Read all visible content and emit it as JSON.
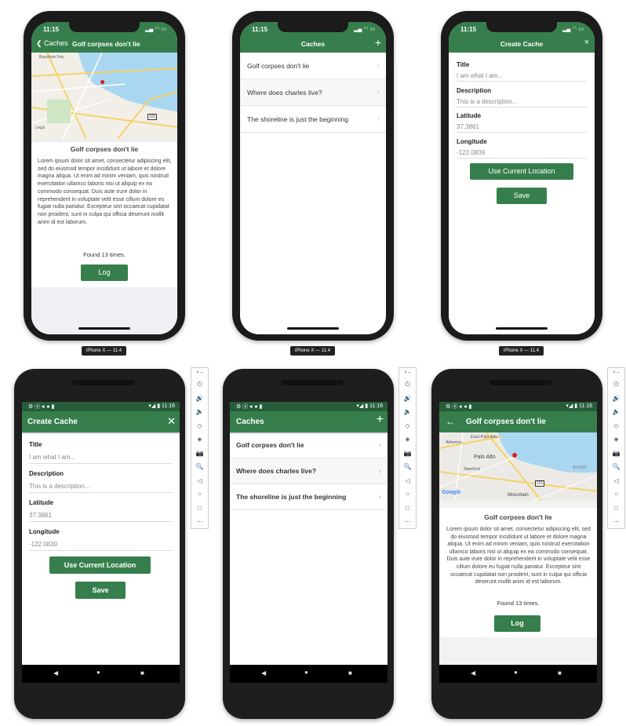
{
  "ios": {
    "time": "11:15",
    "device_label": "iPhone X — 11.4",
    "detail": {
      "back": "Caches",
      "title": "Golf corpses don't lie",
      "heading": "Golf corpses don't lie",
      "description": "Lorem ipsum dolor sit amet, consectetur adipiscing elit, sed do eiusmod tempor incididunt ut labore et dolore magna aliqua. Ut enim ad minim veniam, quis nostrud exercitation ullamco laboris nisi ut aliquip ex ea commodo consequat. Duis aute irure dolor in reprehenderit in voluptate velit esse cillum dolore eu fugiat nulla pariatur. Excepteur sint occaecat cupidatat non proident, sunt in culpa qui officia deserunt mollit anim id est laborum.",
      "found": "Found 13 times.",
      "log": "Log",
      "map_labels": {
        "road": "Bayshore Fwy",
        "hwy": "101",
        "legal": "Legal"
      }
    },
    "list": {
      "title": "Caches",
      "add": "+",
      "items": [
        "Golf corpses don't lie",
        "Where does charles live?",
        "The shoreline is just the beginning"
      ]
    },
    "create": {
      "title": "Create Cache",
      "close": "×",
      "fields": [
        {
          "label": "Title",
          "placeholder": "I am what I am..."
        },
        {
          "label": "Description",
          "placeholder": "This is a description..."
        },
        {
          "label": "Latitude",
          "value": "37.3861"
        },
        {
          "label": "Longitude",
          "value": "-122.0839"
        }
      ],
      "use_location": "Use Current Location",
      "save": "Save"
    }
  },
  "android": {
    "time": "11:16",
    "create": {
      "title": "Create Cache",
      "close": "✕",
      "fields": [
        {
          "label": "Title",
          "placeholder": "I am what I am..."
        },
        {
          "label": "Description",
          "placeholder": "This is a description..."
        },
        {
          "label": "Latitude",
          "value": "37.3861"
        },
        {
          "label": "Longitude",
          "value": "-122.0839"
        }
      ],
      "use_location": "Use Current Location",
      "save": "Save"
    },
    "list": {
      "title": "Caches",
      "add": "+",
      "items": [
        "Golf corpses don't lie",
        "Where does charles live?",
        "The shoreline is just the beginning"
      ]
    },
    "detail": {
      "back": "←",
      "title": "Golf corpses don't lie",
      "heading": "Golf corpses don't lie",
      "description": "Lorem ipsum dolor sit amet, consectetur adipiscing elit, sed do eiusmod tempor incididunt ut labore et dolore magna aliqua. Ut enim ad minim veniam, quis nostrud exercitation ullamco laboris nisi ut aliquip ex ea commodo consequat. Duis aute irure dolor in reprehenderit in voluptate velit esse cillum dolore eu fugiat nulla pariatur. Excepteur sint occaecat cupidatat non proident, sunt in culpa qui officia deserunt mollit anim id est laborum.",
      "found": "Found 13 times.",
      "log": "Log",
      "map_labels": {
        "a": "East Palo Alto",
        "b": "Atherton",
        "c": "Palo Alto",
        "d": "Stanford",
        "e": "ALVISO",
        "f": "Mountain",
        "g": "Google",
        "hwy": "101"
      }
    },
    "emulator_tools": [
      "⏻",
      "🔊",
      "🔉",
      "◇",
      "◈",
      "📷",
      "🔍",
      "◁",
      "○",
      "□",
      "⋯"
    ]
  },
  "colors": {
    "primary": "#367f4c",
    "status": "#275e39"
  }
}
